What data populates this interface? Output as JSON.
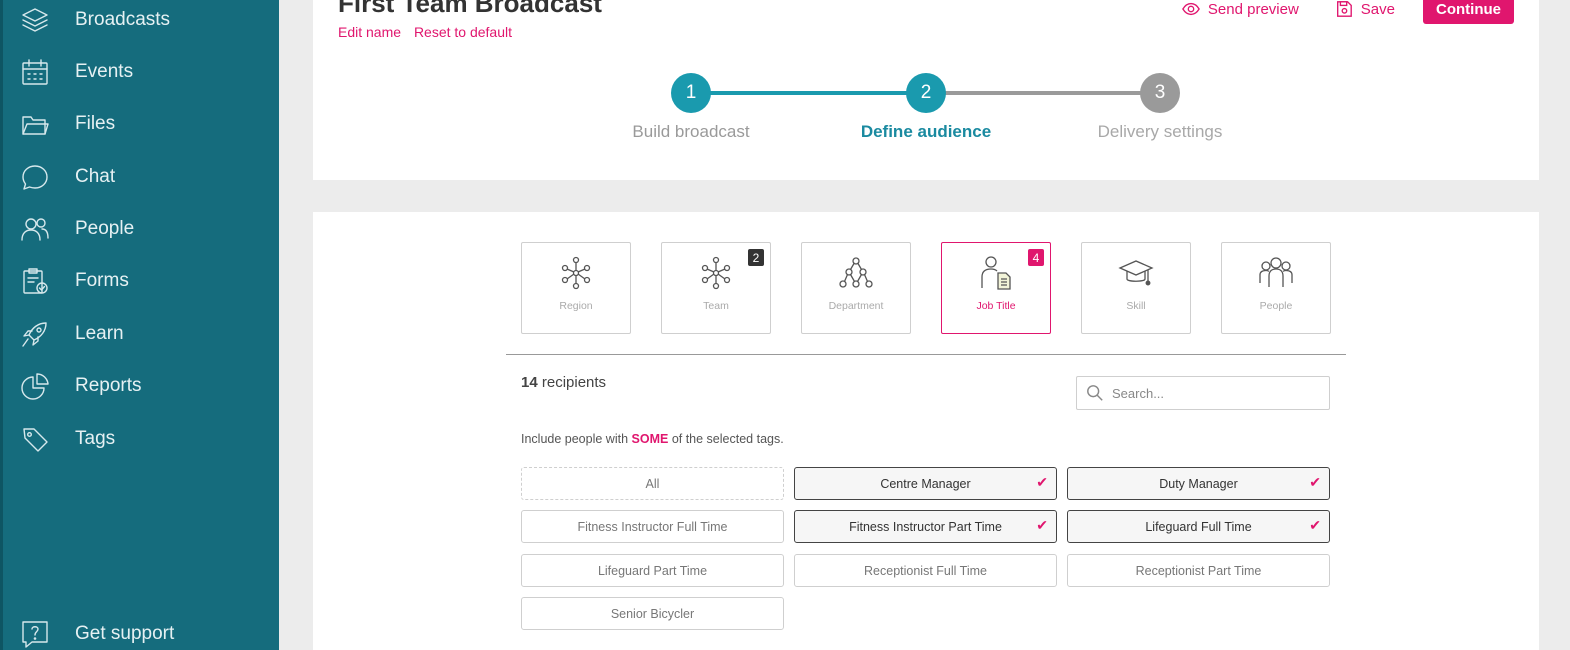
{
  "sidebar": {
    "items": [
      {
        "label": "Broadcasts",
        "icon": "layers-icon"
      },
      {
        "label": "Events",
        "icon": "calendar-icon"
      },
      {
        "label": "Files",
        "icon": "folder-icon"
      },
      {
        "label": "Chat",
        "icon": "chat-bubble-icon"
      },
      {
        "label": "People",
        "icon": "people-icon"
      },
      {
        "label": "Forms",
        "icon": "clipboard-check-icon"
      },
      {
        "label": "Learn",
        "icon": "rocket-icon"
      },
      {
        "label": "Reports",
        "icon": "pie-chart-icon"
      },
      {
        "label": "Tags",
        "icon": "tag-icon"
      }
    ],
    "support": {
      "label": "Get support",
      "icon": "help-icon"
    }
  },
  "header": {
    "title": "First Team Broadcast",
    "edit_name": "Edit name",
    "reset_default": "Reset to default",
    "send_preview": "Send preview",
    "save": "Save",
    "continue": "Continue"
  },
  "stepper": {
    "steps": [
      {
        "number": "1",
        "label": "Build broadcast",
        "state": "done"
      },
      {
        "number": "2",
        "label": "Define audience",
        "state": "active"
      },
      {
        "number": "3",
        "label": "Delivery settings",
        "state": "pending"
      }
    ]
  },
  "audience": {
    "categories": [
      {
        "label": "Region",
        "icon": "org-network-icon",
        "badge": ""
      },
      {
        "label": "Team",
        "icon": "org-network-icon",
        "badge": "2"
      },
      {
        "label": "Department",
        "icon": "hierarchy-icon",
        "badge": ""
      },
      {
        "label": "Job Title",
        "icon": "person-document-icon",
        "badge": "4",
        "active": true
      },
      {
        "label": "Skill",
        "icon": "graduation-cap-icon",
        "badge": ""
      },
      {
        "label": "People",
        "icon": "group-icon",
        "badge": ""
      }
    ],
    "recipients_count": "14",
    "recipients_label": "recipients",
    "search_placeholder": "Search...",
    "include_prefix": "Include people with",
    "include_mode": "SOME",
    "include_suffix": "of the selected tags.",
    "check_glyph": "✔",
    "tags": [
      {
        "label": "All",
        "selected": false
      },
      {
        "label": "Centre Manager",
        "selected": true
      },
      {
        "label": "Duty Manager",
        "selected": true
      },
      {
        "label": "Fitness Instructor Full Time",
        "selected": false
      },
      {
        "label": "Fitness Instructor Part Time",
        "selected": true
      },
      {
        "label": "Lifeguard Full Time",
        "selected": true
      },
      {
        "label": "Lifeguard Part Time",
        "selected": false
      },
      {
        "label": "Receptionist Full Time",
        "selected": false
      },
      {
        "label": "Receptionist Part Time",
        "selected": false
      },
      {
        "label": "Senior Bicycler",
        "selected": false
      }
    ]
  },
  "colors": {
    "sidebar_bg": "#156c7d",
    "accent_pink": "#e0166e",
    "step_teal": "#1a9aae",
    "step_grey": "#9a9a9a",
    "badge_dark": "#333333"
  }
}
